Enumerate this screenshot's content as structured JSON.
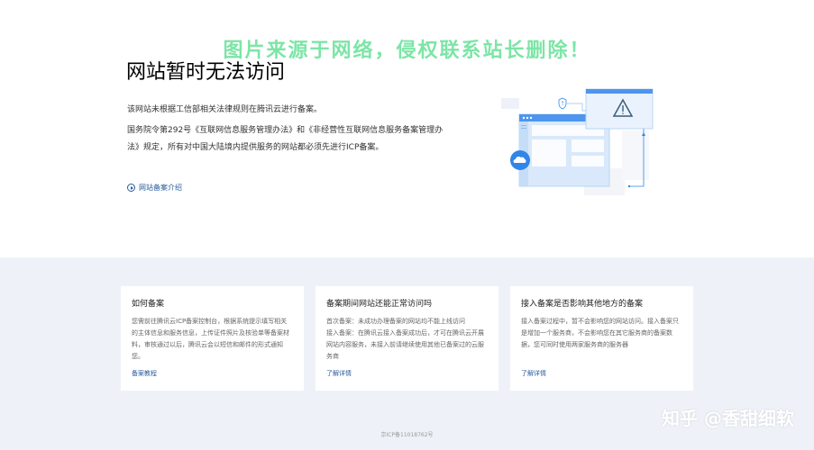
{
  "watermark": {
    "top_text": "图片来源于网络，侵权联系站长删除！",
    "bottom_text": "知乎 @香甜细软"
  },
  "hero": {
    "title": "网站暂时无法访问",
    "paragraph1": "该网站未根据工信部相关法律规则在腾讯云进行备案。",
    "paragraph2": "国务院令第292号《互联网信息服务管理办法》和《非经营性互联网信息服务备案管理办法》规定，所有对中国大陆境内提供服务的网站都必须先进行ICP备案。",
    "intro_link": "网站备案介绍"
  },
  "cards": [
    {
      "title": "如何备案",
      "body": "您需前往腾讯云ICP备案控制台，根据系统提示填写相关的主体信息和服务信息，上传证件照片及核验单等备案材料，审核通过以后，腾讯云会以短信和邮件的形式通知您。",
      "link": "备案教程"
    },
    {
      "title": "备案期间网站还能正常访问吗",
      "body": "首次备案：未成功办理备案的网站均不能上线访问\n接入备案：在腾讯云接入备案成功后，才可在腾讯云开展网站内容服务，未接入前请继续使用其他已备案过的云服务商",
      "link": "了解详情"
    },
    {
      "title": "接入备案是否影响其他地方的备案",
      "body": "接入备案过程中，暂不会影响您的网站访问。接入备案只是增加一个服务商，不会影响您在其它服务商的备案数据，您可同时使用两家服务商的服务器",
      "link": "了解详情"
    }
  ],
  "footer": {
    "icp": "京ICP备11018762号"
  },
  "colors": {
    "accent": "#2a5a9c",
    "band_bg": "#eef2f8",
    "watermark_green": "#6ee39d",
    "illustration_blue": "#2f86e8"
  },
  "icons": {
    "intro_link": "play-circle-icon",
    "illustration": "cloud-warning-illustration"
  }
}
